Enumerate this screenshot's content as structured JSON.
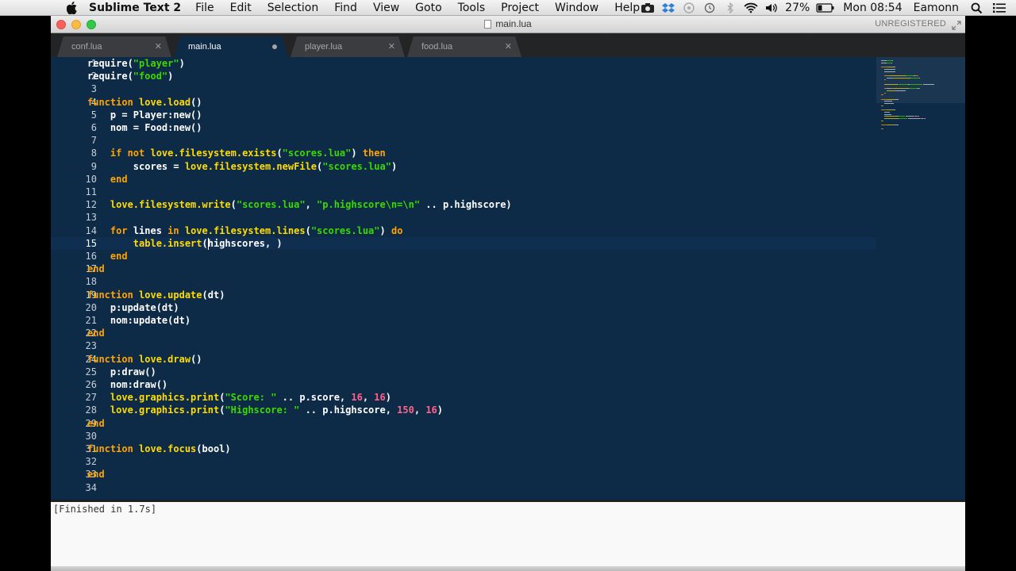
{
  "menubar": {
    "app_name": "Sublime Text 2",
    "items": [
      "File",
      "Edit",
      "Selection",
      "Find",
      "View",
      "Goto",
      "Tools",
      "Project",
      "Window",
      "Help"
    ],
    "battery": "27%",
    "clock": "Mon 08:54",
    "user": "Eamonn"
  },
  "window": {
    "title": "main.lua",
    "unregistered": "UNREGISTERED"
  },
  "tabs": [
    {
      "label": "conf.lua",
      "active": false,
      "dirty": false
    },
    {
      "label": "main.lua",
      "active": true,
      "dirty": true
    },
    {
      "label": "player.lua",
      "active": false,
      "dirty": false
    },
    {
      "label": "food.lua",
      "active": false,
      "dirty": false
    }
  ],
  "editor": {
    "current_line": 15,
    "lines": [
      {
        "n": "1",
        "tokens": [
          [
            "pl",
            "require("
          ],
          [
            "st",
            "\"player\""
          ],
          [
            "pl",
            ")"
          ]
        ]
      },
      {
        "n": "2",
        "tokens": [
          [
            "pl",
            "require("
          ],
          [
            "st",
            "\"food\""
          ],
          [
            "pl",
            ")"
          ]
        ]
      },
      {
        "n": "3",
        "tokens": []
      },
      {
        "n": "4",
        "tokens": [
          [
            "kw",
            "function "
          ],
          [
            "fn",
            "love.load"
          ],
          [
            "pl",
            "()"
          ]
        ]
      },
      {
        "n": "5",
        "tokens": [
          [
            "pl",
            "    p = Player:new()"
          ]
        ]
      },
      {
        "n": "6",
        "tokens": [
          [
            "pl",
            "    nom = Food:new()"
          ]
        ]
      },
      {
        "n": "7",
        "tokens": []
      },
      {
        "n": "8",
        "tokens": [
          [
            "pl",
            "    "
          ],
          [
            "kw",
            "if not "
          ],
          [
            "fn",
            "love.filesystem.exists"
          ],
          [
            "pl",
            "("
          ],
          [
            "st",
            "\"scores.lua\""
          ],
          [
            "pl",
            ") "
          ],
          [
            "kw",
            "then"
          ]
        ]
      },
      {
        "n": "9",
        "tokens": [
          [
            "pl",
            "        scores = "
          ],
          [
            "fn",
            "love.filesystem.newFile"
          ],
          [
            "pl",
            "("
          ],
          [
            "st",
            "\"scores.lua\""
          ],
          [
            "pl",
            ")"
          ]
        ]
      },
      {
        "n": "10",
        "tokens": [
          [
            "pl",
            "    "
          ],
          [
            "kw",
            "end"
          ]
        ]
      },
      {
        "n": "11",
        "tokens": []
      },
      {
        "n": "12",
        "tokens": [
          [
            "pl",
            "    "
          ],
          [
            "fn",
            "love.filesystem.write"
          ],
          [
            "pl",
            "("
          ],
          [
            "st",
            "\"scores.lua\""
          ],
          [
            "pl",
            ", "
          ],
          [
            "st",
            "\"p.highscore\\n=\\n\""
          ],
          [
            "pl",
            " .. p.highscore)"
          ]
        ]
      },
      {
        "n": "13",
        "tokens": []
      },
      {
        "n": "14",
        "tokens": [
          [
            "pl",
            "    "
          ],
          [
            "kw",
            "for "
          ],
          [
            "pl",
            "lines "
          ],
          [
            "kw",
            "in "
          ],
          [
            "fn",
            "love.filesystem.lines"
          ],
          [
            "pl",
            "("
          ],
          [
            "st",
            "\"scores.lua\""
          ],
          [
            "pl",
            ") "
          ],
          [
            "kw",
            "do"
          ]
        ]
      },
      {
        "n": "15",
        "tokens": [
          [
            "pl",
            "        "
          ],
          [
            "fn",
            "table.insert"
          ],
          [
            "pl",
            "(highscores, )"
          ]
        ]
      },
      {
        "n": "16",
        "tokens": [
          [
            "pl",
            "    "
          ],
          [
            "kw",
            "end"
          ]
        ]
      },
      {
        "n": "17",
        "tokens": [
          [
            "kw",
            "end"
          ]
        ]
      },
      {
        "n": "18",
        "tokens": []
      },
      {
        "n": "19",
        "tokens": [
          [
            "kw",
            "function "
          ],
          [
            "fn",
            "love.update"
          ],
          [
            "pl",
            "(dt)"
          ]
        ]
      },
      {
        "n": "20",
        "tokens": [
          [
            "pl",
            "    p:update(dt)"
          ]
        ]
      },
      {
        "n": "21",
        "tokens": [
          [
            "pl",
            "    nom:update(dt)"
          ]
        ]
      },
      {
        "n": "22",
        "tokens": [
          [
            "kw",
            "end"
          ]
        ]
      },
      {
        "n": "23",
        "tokens": []
      },
      {
        "n": "24",
        "tokens": [
          [
            "kw",
            "function "
          ],
          [
            "fn",
            "love.draw"
          ],
          [
            "pl",
            "()"
          ]
        ]
      },
      {
        "n": "25",
        "tokens": [
          [
            "pl",
            "    p:draw()"
          ]
        ]
      },
      {
        "n": "26",
        "tokens": [
          [
            "pl",
            "    nom:draw()"
          ]
        ]
      },
      {
        "n": "27",
        "tokens": [
          [
            "pl",
            "    "
          ],
          [
            "fn",
            "love.graphics.print"
          ],
          [
            "pl",
            "("
          ],
          [
            "st",
            "\"Score: \""
          ],
          [
            "pl",
            " .. p.score, "
          ],
          [
            "nu",
            "16"
          ],
          [
            "pl",
            ", "
          ],
          [
            "nu",
            "16"
          ],
          [
            "pl",
            ")"
          ]
        ]
      },
      {
        "n": "28",
        "tokens": [
          [
            "pl",
            "    "
          ],
          [
            "fn",
            "love.graphics.print"
          ],
          [
            "pl",
            "("
          ],
          [
            "st",
            "\"Highscore: \""
          ],
          [
            "pl",
            " .. p.highscore, "
          ],
          [
            "nu",
            "150"
          ],
          [
            "pl",
            ", "
          ],
          [
            "nu",
            "16"
          ],
          [
            "pl",
            ")"
          ]
        ]
      },
      {
        "n": "29",
        "tokens": [
          [
            "kw",
            "end"
          ]
        ]
      },
      {
        "n": "30",
        "tokens": []
      },
      {
        "n": "31",
        "tokens": [
          [
            "kw",
            "function "
          ],
          [
            "fn",
            "love.focus"
          ],
          [
            "pl",
            "(bool)"
          ]
        ]
      },
      {
        "n": "32",
        "tokens": []
      },
      {
        "n": "33",
        "tokens": [
          [
            "kw",
            "end"
          ]
        ]
      },
      {
        "n": "34",
        "tokens": []
      }
    ]
  },
  "output_panel": {
    "text": "[Finished in 1.7s]"
  },
  "colors": {
    "background": "#0d2a47",
    "keyword": "#ffa400",
    "function": "#ffdd00",
    "string": "#3ad900",
    "number": "#ff628c"
  }
}
